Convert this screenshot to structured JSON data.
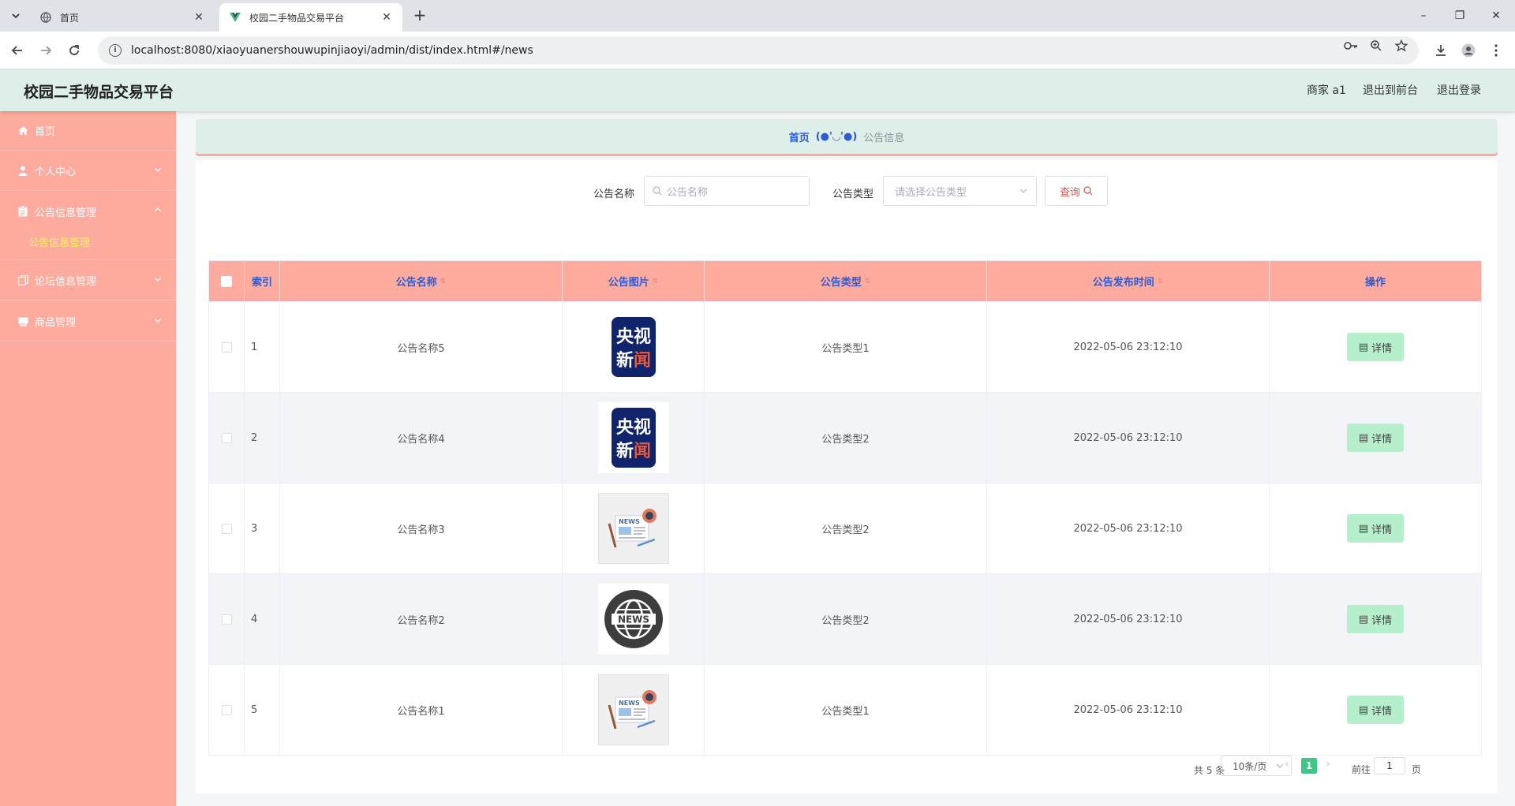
{
  "browser": {
    "tabs": [
      {
        "title": "首页",
        "active": false
      },
      {
        "title": "校园二手物品交易平台",
        "active": true
      }
    ],
    "url": "localhost:8080/xiaoyuanershouwupinjiaoyi/admin/dist/index.html#/news"
  },
  "header": {
    "title": "校园二手物品交易平台",
    "user": "商家 a1",
    "to_front": "退出到前台",
    "logout": "退出登录"
  },
  "sidebar": {
    "items": [
      {
        "label": "首页",
        "icon": "home-icon"
      },
      {
        "label": "个人中心",
        "icon": "user-icon"
      },
      {
        "label": "公告信息管理",
        "icon": "clipboard-icon"
      },
      {
        "label": "论坛信息管理",
        "icon": "copy-icon"
      },
      {
        "label": "商品管理",
        "icon": "box-icon"
      }
    ],
    "active_sub": "公告信息管理"
  },
  "breadcrumb": {
    "home": "首页",
    "face": "(●'◡'●)",
    "current": "公告信息"
  },
  "search": {
    "name_label": "公告名称",
    "name_placeholder": "公告名称",
    "type_label": "公告类型",
    "type_placeholder": "请选择公告类型",
    "query_label": "查询"
  },
  "table": {
    "columns": [
      "索引",
      "公告名称",
      "公告图片",
      "公告类型",
      "公告发布时间",
      "操作"
    ],
    "rows": [
      {
        "index": "1",
        "name": "公告名称5",
        "image": "cctv-news",
        "type": "公告类型1",
        "time": "2022-05-06 23:12:10"
      },
      {
        "index": "2",
        "name": "公告名称4",
        "image": "cctv-news",
        "type": "公告类型2",
        "time": "2022-05-06 23:12:10"
      },
      {
        "index": "3",
        "name": "公告名称3",
        "image": "newspaper",
        "type": "公告类型2",
        "time": "2022-05-06 23:12:10"
      },
      {
        "index": "4",
        "name": "公告名称2",
        "image": "globe-news",
        "type": "公告类型2",
        "time": "2022-05-06 23:12:10"
      },
      {
        "index": "5",
        "name": "公告名称1",
        "image": "newspaper",
        "type": "公告类型1",
        "time": "2022-05-06 23:12:10"
      }
    ],
    "detail_label": "详情"
  },
  "pagination": {
    "total": "共 5 条",
    "page_size": "10条/页",
    "current_page": "1",
    "goto_prefix": "前往",
    "goto_value": "1",
    "goto_suffix": "页"
  },
  "colors": {
    "accent_header": "#ddefe8",
    "sidebar": "#fdab9e",
    "table_head": "#fdab9e",
    "detail_btn": "#b6efcc",
    "active_page": "#3fc78a",
    "link_blue": "#2d5bd6"
  }
}
